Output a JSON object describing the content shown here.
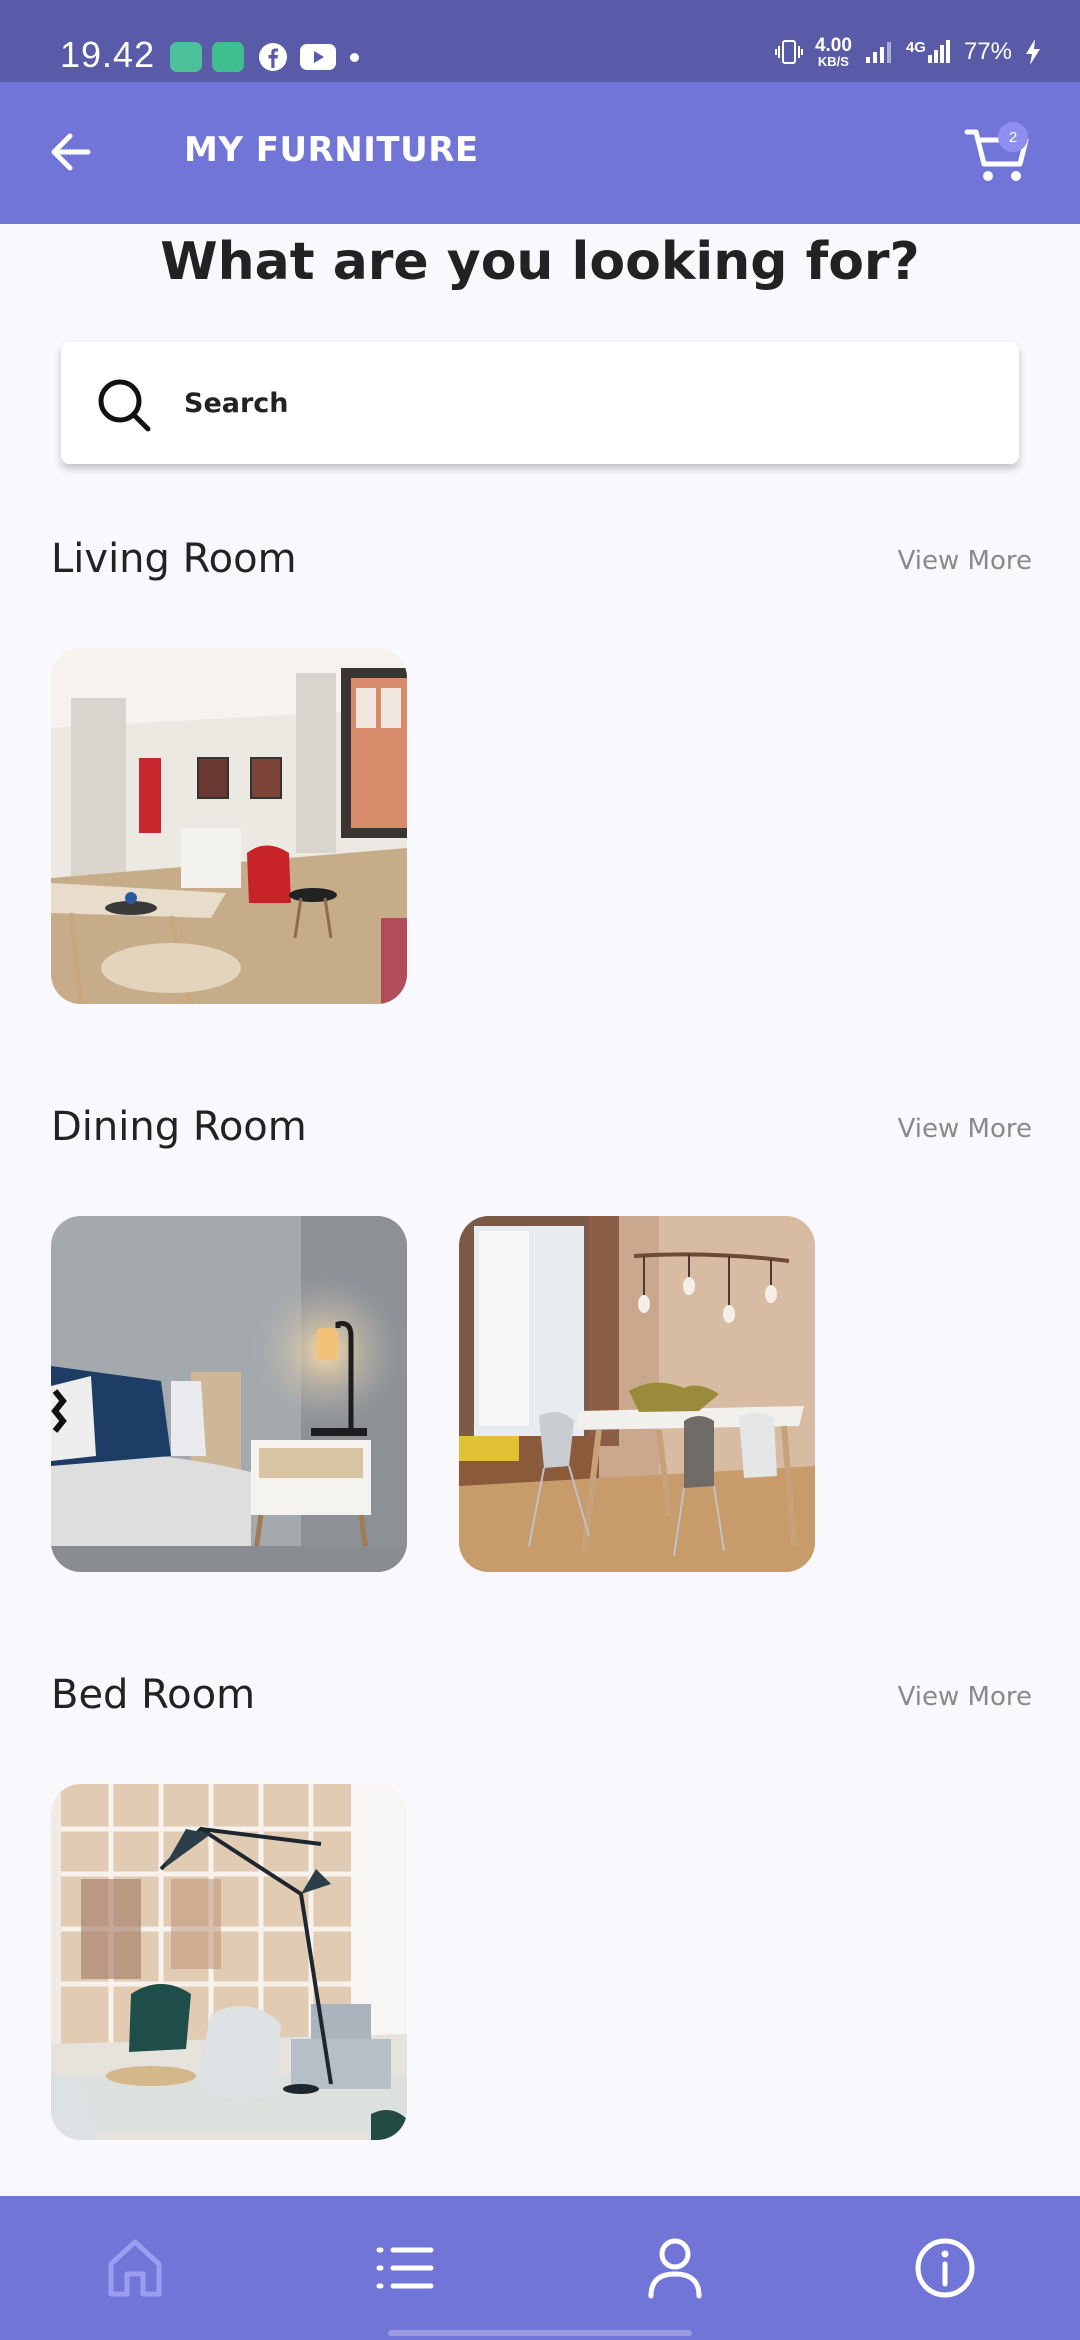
{
  "status_bar": {
    "time": "19.42",
    "speed_value": "4.00",
    "speed_unit": "KB/S",
    "network": "4G",
    "battery": "77%"
  },
  "app_bar": {
    "title": "MY FURNITURE",
    "cart_count": "2"
  },
  "heading": "What are you looking for?",
  "search": {
    "placeholder": "Search"
  },
  "sections": [
    {
      "title": "Living Room",
      "view_more": "View More"
    },
    {
      "title": "Dining Room",
      "view_more": "View More"
    },
    {
      "title": "Bed Room",
      "view_more": "View More"
    }
  ],
  "bottom_nav": {
    "items": [
      "home-icon",
      "list-icon",
      "profile-icon",
      "info-icon"
    ]
  },
  "colors": {
    "primary": "#7275d8",
    "status_bar": "#5a5ba8",
    "background": "#f9f8fd",
    "badge": "#8e8ff0"
  }
}
